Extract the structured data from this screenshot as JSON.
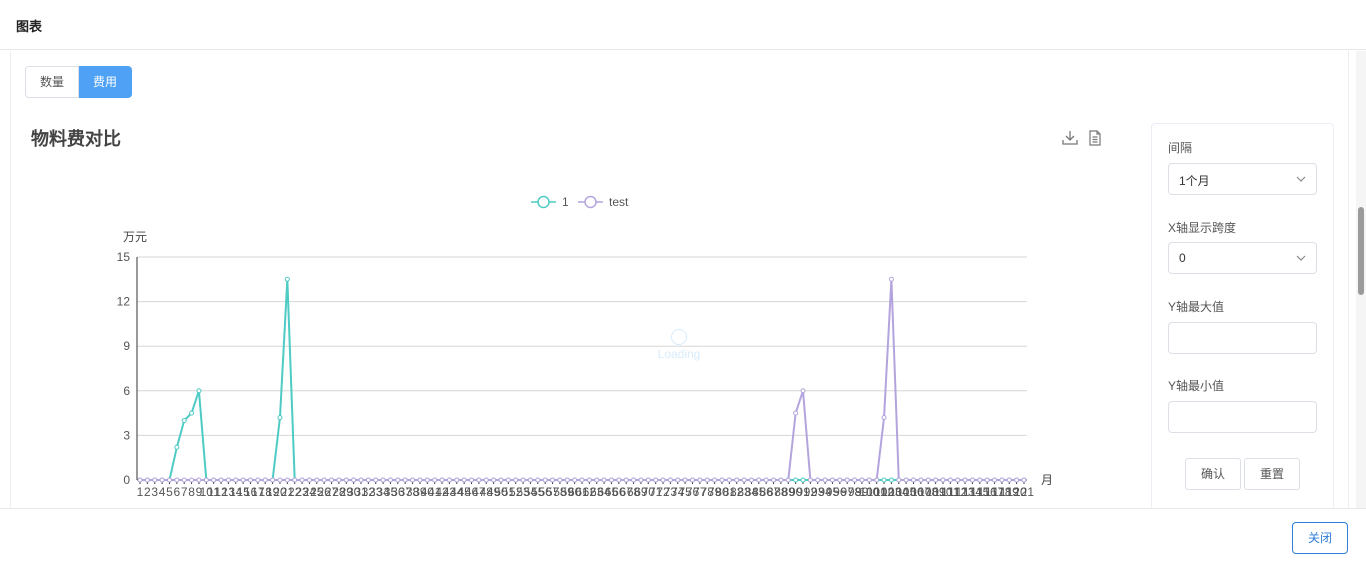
{
  "header": {
    "title": "图表"
  },
  "tabs": [
    {
      "label": "数量",
      "active": false
    },
    {
      "label": "费用",
      "active": true
    }
  ],
  "chart_title": "物料费对比",
  "toolbar": {
    "download_icon": "download-icon",
    "data_view_icon": "document-icon"
  },
  "loading_text": "Loading",
  "panel": {
    "interval_label": "间隔",
    "interval_value": "1个月",
    "x_span_label": "X轴显示跨度",
    "x_span_value": "0",
    "y_max_label": "Y轴最大值",
    "y_max_value": "",
    "y_min_label": "Y轴最小值",
    "y_min_value": "",
    "confirm_label": "确认",
    "reset_label": "重置"
  },
  "footer": {
    "close_label": "关闭"
  },
  "colors": {
    "series1": "#4ecbc4",
    "series2": "#b4a4dd",
    "accent": "#4ea1f5",
    "close": "#2f7ed8"
  },
  "chart_data": {
    "type": "line",
    "ylabel": "万元",
    "xlabel": "月",
    "ylim": [
      0,
      15
    ],
    "yticks": [
      0,
      3,
      6,
      9,
      12,
      15
    ],
    "grid": true,
    "legend_position": "top",
    "x": [
      1,
      2,
      3,
      4,
      5,
      6,
      7,
      8,
      9,
      10,
      11,
      12,
      13,
      14,
      15,
      16,
      17,
      18,
      19,
      20,
      21,
      22,
      23,
      24,
      25,
      26,
      27,
      28,
      29,
      30,
      31,
      32,
      33,
      34,
      35,
      36,
      37,
      38,
      39,
      40,
      41,
      42,
      43,
      44,
      45,
      46,
      47,
      48,
      49,
      50,
      51,
      52,
      53,
      54,
      55,
      56,
      57,
      58,
      59,
      60,
      61,
      62,
      63,
      64,
      65,
      66,
      67,
      68,
      69,
      70,
      71,
      72,
      73,
      74,
      75,
      76,
      77,
      78,
      79,
      80,
      81,
      82,
      83,
      84,
      85,
      86,
      87,
      88,
      89,
      90,
      91,
      92,
      93,
      94,
      95,
      96,
      97,
      98,
      99,
      100,
      101,
      102,
      103,
      104,
      105,
      106,
      107,
      108,
      109,
      110,
      111,
      112,
      113,
      114,
      115,
      116,
      117,
      118,
      119,
      120,
      121
    ],
    "series": [
      {
        "name": "1",
        "values": [
          0,
          0,
          0,
          0,
          0,
          2.2,
          4,
          4.5,
          6,
          0,
          0,
          0,
          0,
          0,
          0,
          0,
          0,
          0,
          0,
          4.2,
          13.5,
          0,
          0,
          0,
          0,
          0,
          0,
          0,
          0,
          0,
          0,
          0,
          0,
          0,
          0,
          0,
          0,
          0,
          0,
          0,
          0,
          0,
          0,
          0,
          0,
          0,
          0,
          0,
          0,
          0,
          0,
          0,
          0,
          0,
          0,
          0,
          0,
          0,
          0,
          0,
          0,
          0,
          0,
          0,
          0,
          0,
          0,
          0,
          0,
          0,
          0,
          0,
          0,
          0,
          0,
          0,
          0,
          0,
          0,
          0,
          0,
          0,
          0,
          0,
          0,
          0,
          0,
          0,
          0,
          0,
          0,
          0,
          0,
          0,
          0,
          0,
          0,
          0,
          0,
          0,
          0,
          0,
          0,
          0,
          0,
          0,
          0,
          0,
          0,
          0,
          0,
          0,
          0,
          0,
          0,
          0,
          0,
          0,
          0,
          0,
          0
        ]
      },
      {
        "name": "test",
        "values": [
          0,
          0,
          0,
          0,
          0,
          0,
          0,
          0,
          0,
          0,
          0,
          0,
          0,
          0,
          0,
          0,
          0,
          0,
          0,
          0,
          0,
          0,
          0,
          0,
          0,
          0,
          0,
          0,
          0,
          0,
          0,
          0,
          0,
          0,
          0,
          0,
          0,
          0,
          0,
          0,
          0,
          0,
          0,
          0,
          0,
          0,
          0,
          0,
          0,
          0,
          0,
          0,
          0,
          0,
          0,
          0,
          0,
          0,
          0,
          0,
          0,
          0,
          0,
          0,
          0,
          0,
          0,
          0,
          0,
          0,
          0,
          0,
          0,
          0,
          0,
          0,
          0,
          0,
          0,
          0,
          0,
          0,
          0,
          0,
          0,
          0,
          0,
          0,
          0,
          4.5,
          6,
          0,
          0,
          0,
          0,
          0,
          0,
          0,
          0,
          0,
          0,
          4.2,
          13.5,
          0,
          0,
          0,
          0,
          0,
          0,
          0,
          0,
          0,
          0,
          0,
          0,
          0,
          0,
          0,
          0,
          0,
          0
        ]
      }
    ]
  }
}
